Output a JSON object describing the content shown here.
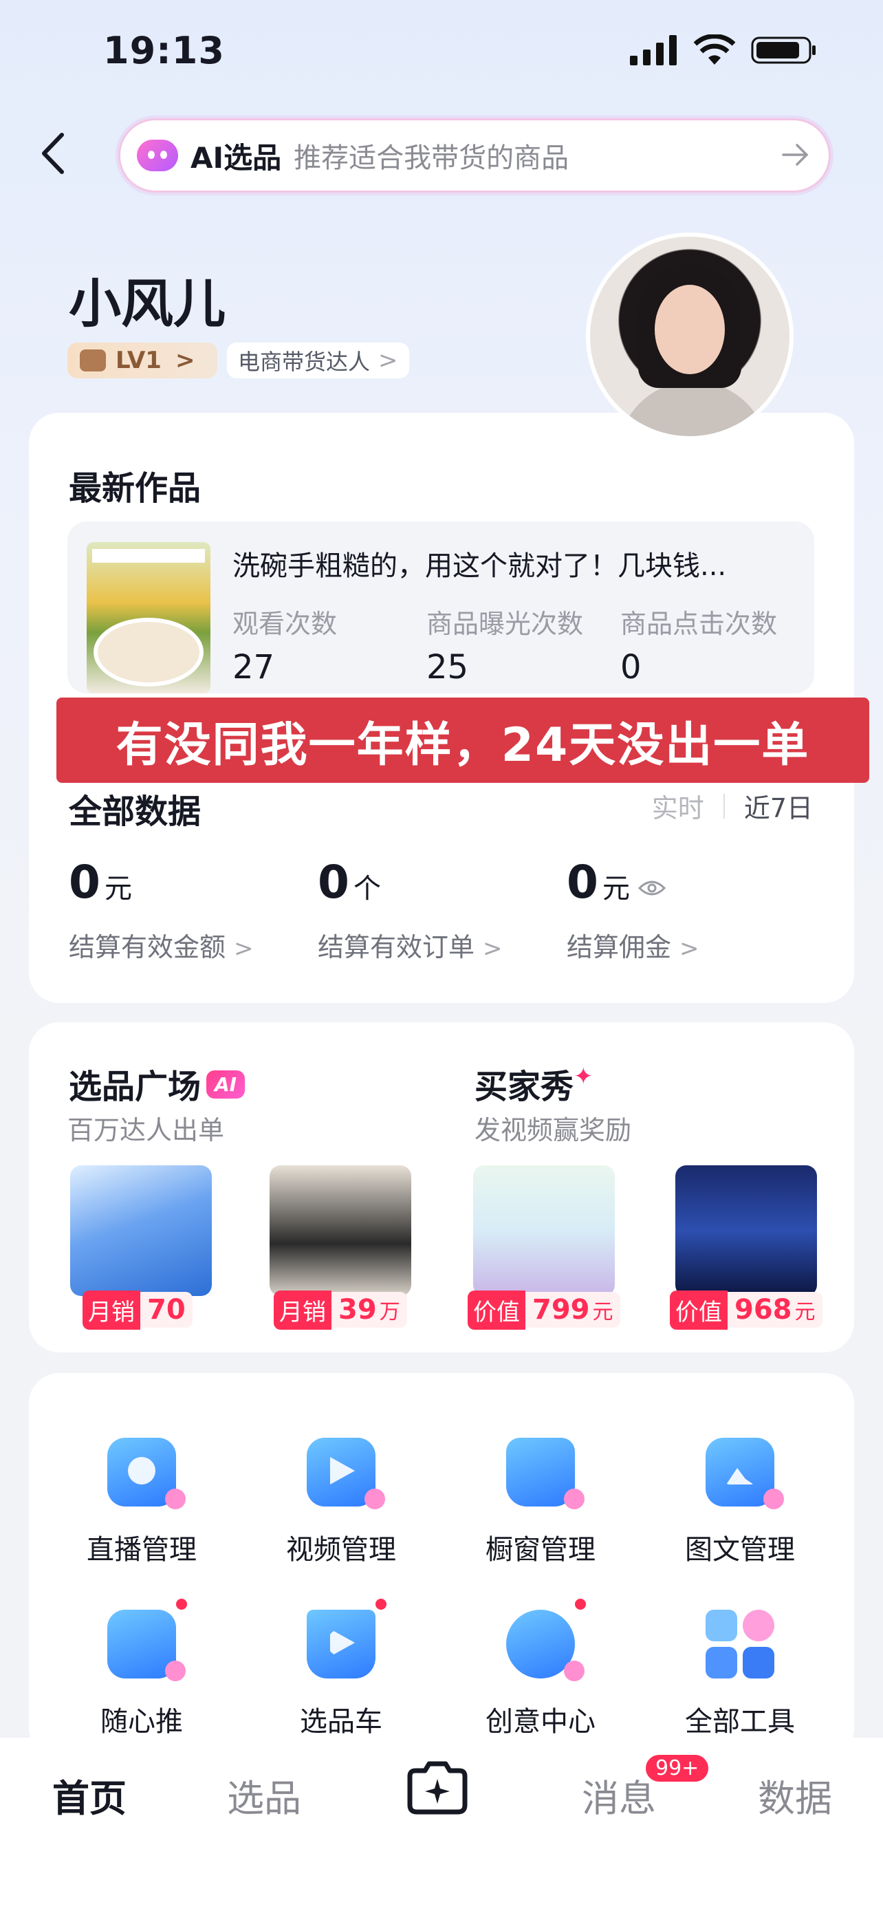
{
  "status_bar": {
    "time": "19:13"
  },
  "search": {
    "ai_label": "AI选品",
    "placeholder": "推荐适合我带货的商品"
  },
  "profile": {
    "name": "小风儿",
    "level": "LV1",
    "role": "电商带货达人"
  },
  "latest_works": {
    "title": "最新作品",
    "caption": "洗碗手粗糙的，用这个就对了！几块钱...",
    "metrics": [
      {
        "label": "观看次数",
        "value": "27"
      },
      {
        "label": "商品曝光次数",
        "value": "25"
      },
      {
        "label": "商品点击次数",
        "value": "0"
      }
    ]
  },
  "overlay_text": "有没同我一年样，24天没出一单",
  "all_data": {
    "title": "全部数据",
    "tabs": [
      "实时",
      "近7日"
    ],
    "stats": [
      {
        "value": "0",
        "unit": "元",
        "label": "结算有效金额"
      },
      {
        "value": "0",
        "unit": "个",
        "label": "结算有效订单"
      },
      {
        "value": "0",
        "unit": "元",
        "label": "结算佣金"
      }
    ]
  },
  "plaza": {
    "title": "选品广场",
    "ai_tag": "AI",
    "subtitle": "百万达人出单",
    "products": [
      {
        "tag": "月销",
        "value": "70",
        "unit": ""
      },
      {
        "tag": "月销",
        "value": "39",
        "unit": "万"
      }
    ]
  },
  "buyer_show": {
    "title": "买家秀",
    "subtitle": "发视频赢奖励",
    "products": [
      {
        "tag": "价值",
        "value": "799",
        "unit": "元"
      },
      {
        "tag": "价值",
        "value": "968",
        "unit": "元"
      }
    ]
  },
  "tools": [
    {
      "label": "直播管理"
    },
    {
      "label": "视频管理"
    },
    {
      "label": "橱窗管理"
    },
    {
      "label": "图文管理"
    },
    {
      "label": "随心推"
    },
    {
      "label": "选品车"
    },
    {
      "label": "创意中心"
    },
    {
      "label": "全部工具"
    }
  ],
  "tabbar": {
    "home": "首页",
    "select": "选品",
    "message": "消息",
    "message_badge": "99+",
    "data": "数据"
  },
  "colors": {
    "accent": "#ff2d55",
    "banner": "#d93a46",
    "ai_gradient": "#ff6fd0"
  }
}
